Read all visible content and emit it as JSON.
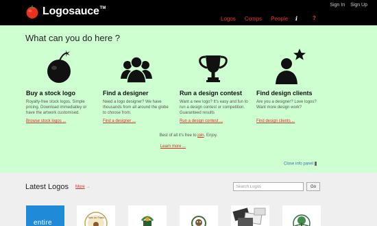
{
  "header": {
    "brand": "Logosauce",
    "brand_tm": "TM",
    "auth": {
      "sign_in": "Sign In",
      "sign_up": "Sign Up"
    },
    "nav": [
      "Logos",
      "Comps",
      "People"
    ],
    "info_icon": "i",
    "help_icon": "?"
  },
  "panel": {
    "title": "What can you do here ?",
    "features": [
      {
        "icon": "tomato-bomb-icon",
        "title": "Buy a stock logo",
        "text": "Royalty-free stock logos. Simple pricing. Download immediatley or have the artwork customised.",
        "link": "Browse stock logos ..."
      },
      {
        "icon": "people-group-icon",
        "title": "Find a designer",
        "text": "Need a logo designer? We have thousands from all around the globe to choose from.",
        "link": "Find a designer ..."
      },
      {
        "icon": "trophy-icon",
        "title": "Run a design contest",
        "text": "Want a new logo? It's easy and fun to run a design contest or competition. Guaranteed results",
        "link": "Run a design contest ..."
      },
      {
        "icon": "person-star-icon",
        "title": "Find design clients",
        "text": "Are you a designer? Love logos? Want more design work?",
        "link": "Find design clients ..."
      }
    ],
    "free_text_before": "Best of all it's free to",
    "free_join": "join",
    "free_text_after": ". Enjoy.",
    "learn_more": "Learn more ...",
    "close": "Close info panel"
  },
  "latest": {
    "title": "Latest Logos",
    "more": "More",
    "more_arrow": "→",
    "search_placeholder": "Search Logos",
    "go": "Go",
    "first_thumb_label": "entire",
    "second_thumb_text": "Tails on Trails"
  },
  "colors": {
    "header_bg": "#000000",
    "panel_bg": "#ceffd1",
    "accent_red": "#e53a2a",
    "link_blue": "#3b6fb6",
    "thumb_blue": "#1e8ad8"
  }
}
